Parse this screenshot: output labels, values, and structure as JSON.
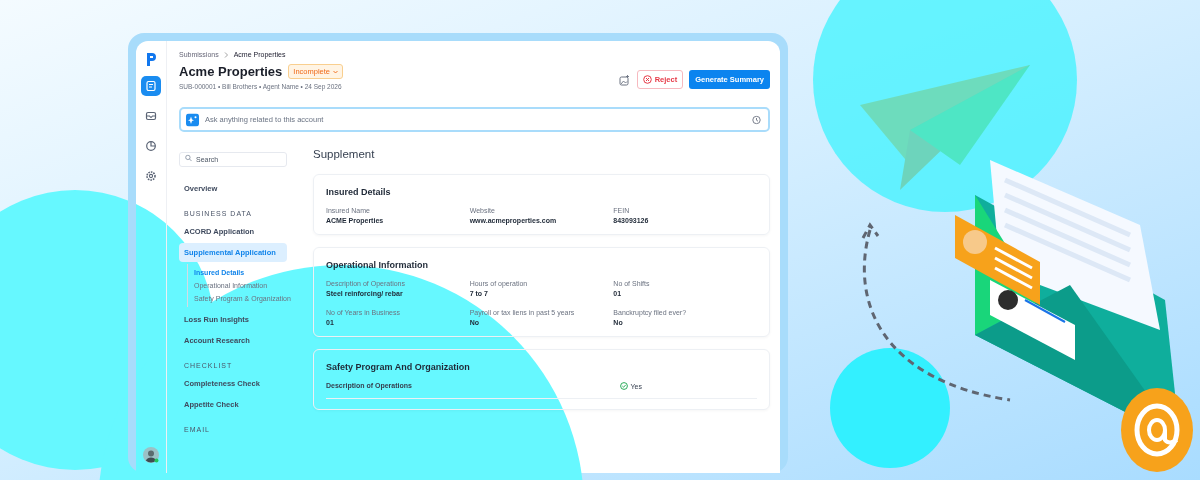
{
  "rail": [
    {
      "kind": "logo"
    },
    {
      "kind": "document",
      "selected": true
    },
    {
      "kind": "inbox",
      "selected": false
    },
    {
      "kind": "chart",
      "selected": false
    },
    {
      "kind": "settings",
      "selected": false
    }
  ],
  "breadcrumb": [
    "Submissions",
    "Acme Properties"
  ],
  "title": "Acme Properties",
  "status": "Incomplete",
  "meta": "SUB-000001 • Bill Brothers • Agent Name • 24 Sep 2026",
  "actions": [
    {
      "kind": "icon"
    },
    {
      "kind": "reject",
      "label": "Reject"
    },
    {
      "kind": "primary",
      "label": "Generate Summary"
    }
  ],
  "ask": {
    "placeholder": "Ask anything related to this account"
  },
  "nav": {
    "search": {
      "placeholder": "Search"
    },
    "items": [
      {
        "kind": "item",
        "label": "Overview",
        "selected": false
      },
      {
        "kind": "section",
        "label": "BUSINESS DATA"
      },
      {
        "kind": "item",
        "label": "ACORD Application",
        "selected": false
      },
      {
        "kind": "item",
        "label": "Supplemental Application",
        "selected": true,
        "children": [
          {
            "label": "Insured Details",
            "selected": true
          },
          {
            "label": "Operational Information",
            "selected": false
          },
          {
            "label": "Safety Program & Organization",
            "selected": false
          }
        ]
      },
      {
        "kind": "item",
        "label": "Loss Run Insights",
        "selected": false
      },
      {
        "kind": "item",
        "label": "Account Research",
        "selected": false
      },
      {
        "kind": "section",
        "label": "CHECKLIST"
      },
      {
        "kind": "item",
        "label": "Completeness Check",
        "selected": false
      },
      {
        "kind": "item",
        "label": "Appetite Check",
        "selected": false
      },
      {
        "kind": "section",
        "label": "EMAIL"
      }
    ]
  },
  "main": {
    "heading": "Supplement",
    "cards": [
      {
        "kind": "fields",
        "title": "Insured Details",
        "fields": [
          {
            "label": "Insured Name",
            "value": "ACME Properties"
          },
          {
            "label": "Website",
            "value": "www.acmeproperties.com"
          },
          {
            "label": "FEIN",
            "value": "843093126"
          }
        ]
      },
      {
        "kind": "fields",
        "title": "Operational Information",
        "fields": [
          {
            "label": "Description of Operations",
            "value": "Steel reinforcing/ rebar"
          },
          {
            "label": "Hours of operation",
            "value": "7 to 7"
          },
          {
            "label": "No of Shifts",
            "value": "01"
          },
          {
            "label": "No of Years in Business",
            "value": "01"
          },
          {
            "label": "Payroll or tax liens in past 5 years",
            "value": "No"
          },
          {
            "label": "Banckruptcy filed ever?",
            "value": "No"
          }
        ]
      },
      {
        "kind": "checks",
        "title": "Safety Program And Organization",
        "rows": [
          {
            "label": "Description of Operations",
            "value": "Yes",
            "checked": true
          }
        ]
      }
    ]
  }
}
